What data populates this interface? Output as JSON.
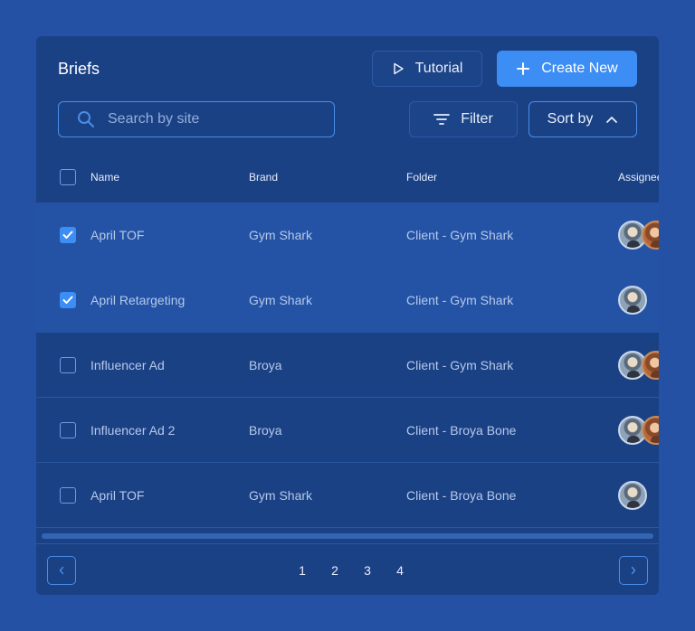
{
  "header": {
    "title": "Briefs",
    "tutorial_label": "Tutorial",
    "create_label": "Create New"
  },
  "toolbar": {
    "search_placeholder": "Search by site",
    "filter_label": "Filter",
    "sort_label": "Sort by"
  },
  "table": {
    "columns": [
      "Name",
      "Brand",
      "Folder",
      "Assignee"
    ],
    "rows": [
      {
        "name": "April TOF",
        "brand": "Gym Shark",
        "folder": "Client - Gym Shark",
        "checked": true,
        "avatars": 2
      },
      {
        "name": "April Retargeting",
        "brand": "Gym Shark",
        "folder": "Client - Gym Shark",
        "checked": true,
        "avatars": 1
      },
      {
        "name": "Influencer Ad",
        "brand": "Broya",
        "folder": "Client - Gym Shark",
        "checked": false,
        "avatars": 2
      },
      {
        "name": "Influencer Ad 2",
        "brand": "Broya",
        "folder": "Client - Broya Bone",
        "checked": false,
        "avatars": 2
      },
      {
        "name": "April TOF",
        "brand": "Gym Shark",
        "folder": "Client - Broya Bone",
        "checked": false,
        "avatars": 1
      }
    ]
  },
  "pagination": {
    "pages": [
      "1",
      "2",
      "3",
      "4"
    ]
  },
  "colors": {
    "background": "#2451a3",
    "panel": "#1b4185",
    "accent": "#3d8ef4",
    "selected_row": "#2453a5"
  }
}
